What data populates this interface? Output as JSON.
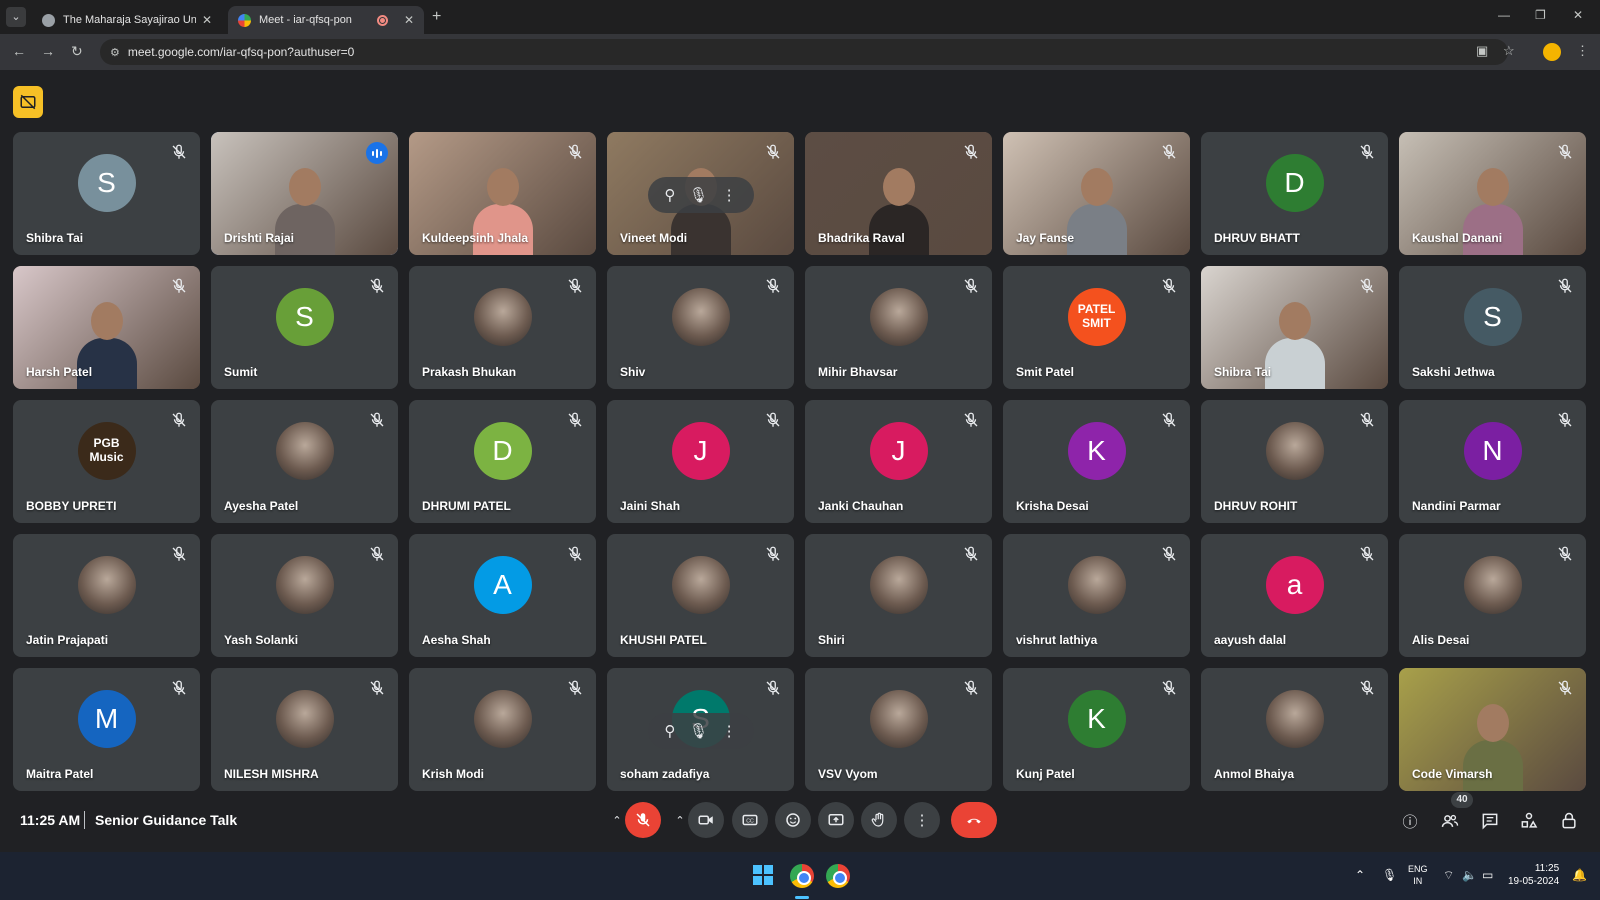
{
  "browser": {
    "tabs": [
      {
        "title": "The Maharaja Sayajirao Univers",
        "active": false
      },
      {
        "title": "Meet - iar-qfsq-pon",
        "active": true
      }
    ],
    "url": "meet.google.com/iar-qfsq-pon?authuser=0"
  },
  "meet": {
    "participants": [
      {
        "name": "Shibra Tai",
        "type": "initial",
        "initial": "S",
        "color": "#78909c"
      },
      {
        "name": "Drishti Rajai",
        "type": "video",
        "speaking": true,
        "tone": "#c8c2bc",
        "shirt": "#6e6461"
      },
      {
        "name": "Kuldeepsinh Jhala",
        "type": "video",
        "tone": "#b49a87",
        "shirt": "#e0958a"
      },
      {
        "name": "Vineet Modi",
        "type": "video",
        "tone": "#8f7a61",
        "shirt": "#3a3330",
        "hover": true
      },
      {
        "name": "Bhadrika Raval",
        "type": "video",
        "tone": "#5c4d44",
        "shirt": "#2b2625"
      },
      {
        "name": "Jay Fanse",
        "type": "video",
        "tone": "#cfc1b4",
        "shirt": "#7a7f86"
      },
      {
        "name": "DHRUV BHATT",
        "type": "initial",
        "initial": "D",
        "color": "#2e7d32"
      },
      {
        "name": "Kaushal Danani",
        "type": "video",
        "tone": "#c6bfb5",
        "shirt": "#9c6f86"
      },
      {
        "name": "Harsh Patel",
        "type": "video",
        "tone": "#d8c7c9",
        "shirt": "#273246"
      },
      {
        "name": "Sumit",
        "type": "initial",
        "initial": "S",
        "color": "#689f38"
      },
      {
        "name": "Prakash Bhukan",
        "type": "photo"
      },
      {
        "name": "Shiv",
        "type": "photo"
      },
      {
        "name": "Mihir Bhavsar",
        "type": "photo"
      },
      {
        "name": "Smit Patel",
        "type": "text",
        "text": "PATEL SMIT",
        "color": "#f4511e"
      },
      {
        "name": "Shibra Tai",
        "type": "video",
        "tone": "#d9d4cf",
        "shirt": "#c9d0d3"
      },
      {
        "name": "Sakshi Jethwa",
        "type": "initial",
        "initial": "S",
        "color": "#455a64"
      },
      {
        "name": "BOBBY UPRETI",
        "type": "text",
        "text": "PGB Music",
        "color": "#3b2a1a"
      },
      {
        "name": "Ayesha Patel",
        "type": "photo"
      },
      {
        "name": "DHRUMI PATEL",
        "type": "initial",
        "initial": "D",
        "color": "#7cb342"
      },
      {
        "name": "Jaini Shah",
        "type": "initial",
        "initial": "J",
        "color": "#d81b60"
      },
      {
        "name": "Janki Chauhan",
        "type": "initial",
        "initial": "J",
        "color": "#d81b60"
      },
      {
        "name": "Krisha Desai",
        "type": "initial",
        "initial": "K",
        "color": "#8e24aa"
      },
      {
        "name": "DHRUV ROHIT",
        "type": "photo"
      },
      {
        "name": "Nandini Parmar",
        "type": "initial",
        "initial": "N",
        "color": "#7b1fa2"
      },
      {
        "name": "Jatin Prajapati",
        "type": "photo"
      },
      {
        "name": "Yash Solanki",
        "type": "photo"
      },
      {
        "name": "Aesha Shah",
        "type": "initial",
        "initial": "A",
        "color": "#039be5"
      },
      {
        "name": "KHUSHI PATEL",
        "type": "photo"
      },
      {
        "name": "Shiri",
        "type": "photo"
      },
      {
        "name": "vishrut lathiya",
        "type": "photo"
      },
      {
        "name": "aayush dalal",
        "type": "initial",
        "initial": "a",
        "color": "#d81b60"
      },
      {
        "name": "Alis Desai",
        "type": "photo"
      },
      {
        "name": "Maitra Patel",
        "type": "initial",
        "initial": "M",
        "color": "#1565c0"
      },
      {
        "name": "NILESH MISHRA",
        "type": "photo"
      },
      {
        "name": "Krish Modi",
        "type": "photo"
      },
      {
        "name": "soham zadafiya",
        "type": "initial",
        "initial": "S",
        "color": "#00796b",
        "hover": true
      },
      {
        "name": "VSV Vyom",
        "type": "photo"
      },
      {
        "name": "Kunj Patel",
        "type": "initial",
        "initial": "K",
        "color": "#2e7d32"
      },
      {
        "name": "Anmol Bhaiya",
        "type": "photo"
      },
      {
        "name": "Code Vimarsh",
        "type": "video",
        "tone": "#a8a04a",
        "shirt": "#6a6f44"
      }
    ],
    "time": "11:25 AM",
    "meeting_name": "Senior Guidance Talk",
    "people_count": "40"
  },
  "taskbar": {
    "lang_top": "ENG",
    "lang_bottom": "IN",
    "clock_time": "11:25",
    "clock_date": "19-05-2024"
  },
  "colors": {
    "accent": "#8ab4f8",
    "end_call": "#ea4335",
    "meet_bg": "#202124",
    "tile_bg": "#3c4043"
  }
}
